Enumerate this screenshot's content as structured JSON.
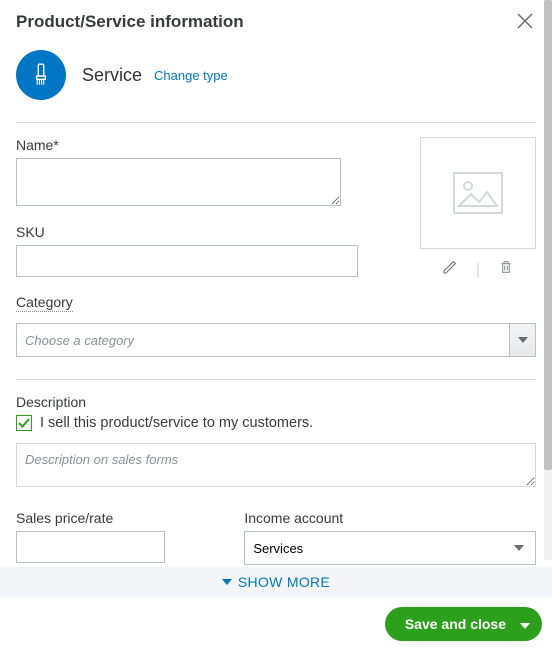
{
  "header": {
    "title": "Product/Service information"
  },
  "type": {
    "label": "Service",
    "change_link": "Change type"
  },
  "fields": {
    "name_label": "Name*",
    "name_value": "",
    "sku_label": "SKU",
    "sku_value": "",
    "category_label": "Category",
    "category_placeholder": "Choose a category",
    "category_value": "",
    "description_label": "Description",
    "sell_checkbox_label": "I sell this product/service to my customers.",
    "sell_checked": true,
    "description_placeholder": "Description on sales forms",
    "description_value": "",
    "price_label": "Sales price/rate",
    "price_value": "",
    "income_label": "Income account",
    "income_value": "Services"
  },
  "actions": {
    "show_more": "SHOW MORE",
    "save": "Save and close"
  },
  "colors": {
    "primary_blue": "#0077c5",
    "primary_green": "#2ca01c"
  }
}
